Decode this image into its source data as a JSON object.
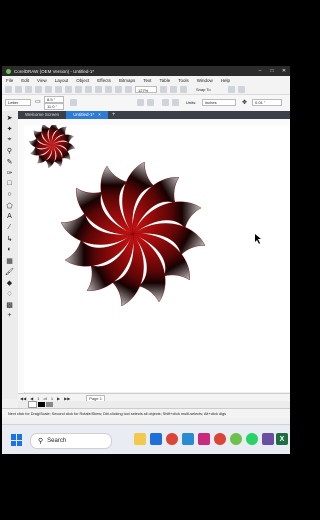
{
  "app": {
    "title": "CorelDRAW (OEM Version) - Untitled-1*"
  },
  "menu": [
    "File",
    "Edit",
    "View",
    "Layout",
    "Object",
    "Effects",
    "Bitmaps",
    "Text",
    "Table",
    "Tools",
    "Window",
    "Help"
  ],
  "toolbar": {
    "zoom": "127%",
    "snap_label": "Snap To"
  },
  "propbar": {
    "page_size": "Letter",
    "width": "8.5 \"",
    "height": "11.0 \"",
    "units_label": "Units:",
    "units": "inches",
    "nudge": "0.01 \""
  },
  "tabs": [
    {
      "label": "Welcome Screen"
    },
    {
      "label": "Untitled-1*"
    }
  ],
  "pagenav": {
    "current": "1",
    "of": "of",
    "total": "1",
    "page_tab": "Page 1"
  },
  "status": {
    "text": "Next click for Drag/Scale; Second click for Rotate/Skew; Dbl-clicking tool selects all objects; Shift+click multi-selects; Alt+click digs"
  },
  "taskbar": {
    "search_placeholder": "Search"
  },
  "colors": {
    "flower_red": "#d10f0f",
    "flower_dark": "#160202",
    "flower_grey": "#bdbdbd",
    "accent_tab": "#2e7bd6"
  }
}
